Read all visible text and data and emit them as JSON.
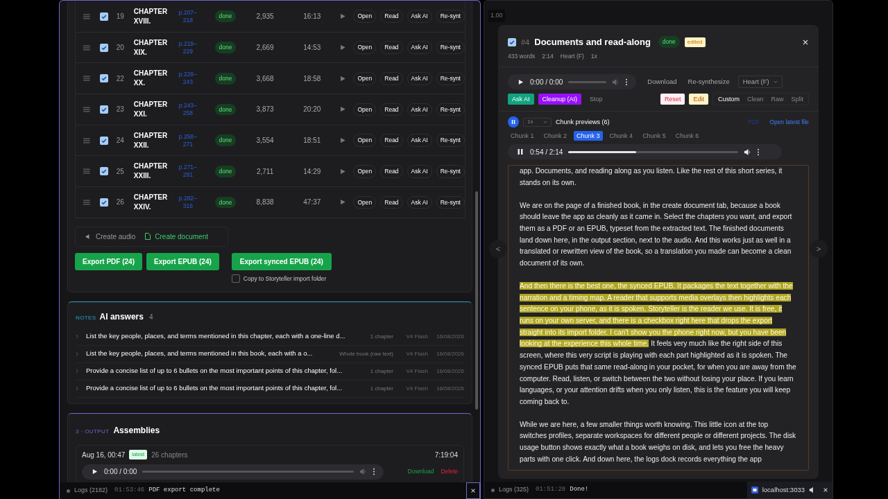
{
  "chapters": {
    "rows": [
      {
        "checked": true,
        "number": "19",
        "title": "CHAPTER XVIII.",
        "pages": "p.207–218",
        "status": "done",
        "words": "2,935",
        "duration": "16:13",
        "actions": [
          "Open",
          "Read",
          "Ask AI",
          "Re-synt"
        ]
      },
      {
        "checked": true,
        "number": "20",
        "title": "CHAPTER XIX.",
        "pages": "p.219–229",
        "status": "done",
        "words": "2,669",
        "duration": "14:53",
        "actions": [
          "Open",
          "Read",
          "Ask AI",
          "Re-synt"
        ]
      },
      {
        "checked": true,
        "number": "22",
        "title": "CHAPTER XX.",
        "pages": "p.229–243",
        "status": "done",
        "words": "3,668",
        "duration": "18:58",
        "actions": [
          "Open",
          "Read",
          "Ask AI",
          "Re-synt"
        ]
      },
      {
        "checked": true,
        "number": "23",
        "title": "CHAPTER XXI.",
        "pages": "p.243–258",
        "status": "done",
        "words": "3,873",
        "duration": "20:20",
        "actions": [
          "Open",
          "Read",
          "Ask AI",
          "Re-synt"
        ]
      },
      {
        "checked": true,
        "number": "24",
        "title": "CHAPTER XXII.",
        "pages": "p.258–271",
        "status": "done",
        "words": "3,554",
        "duration": "18:51",
        "actions": [
          "Open",
          "Read",
          "Ask AI",
          "Re-synt"
        ]
      },
      {
        "checked": true,
        "number": "25",
        "title": "CHAPTER XXIII.",
        "pages": "p.271–281",
        "status": "done",
        "words": "2,711",
        "duration": "14:29",
        "actions": [
          "Open",
          "Read",
          "Ask AI",
          "Re-synt"
        ]
      },
      {
        "checked": true,
        "number": "26",
        "title": "CHAPTER XXIV.",
        "pages": "p.282–316",
        "status": "done",
        "words": "8,838",
        "duration": "47:37",
        "actions": [
          "Open",
          "Read",
          "Ask AI",
          "Re-synt"
        ]
      }
    ],
    "mode_tabs": [
      {
        "label": "Create audio",
        "selected": false,
        "kind": "audio"
      },
      {
        "label": "Create document",
        "selected": true,
        "kind": "document"
      }
    ],
    "export_buttons": [
      "Export PDF (24)",
      "Export EPUB (24)"
    ],
    "synced_button": "Export synced EPUB (24)",
    "copy_option": {
      "label": "Copy to Storyteller import folder",
      "checked": false
    }
  },
  "notes": {
    "eyebrow": "NOTES",
    "title": "AI answers",
    "count": "4",
    "items": [
      {
        "prompt": "List the key people, places, and terms mentioned in this chapter, each with a one-line d...",
        "scope": "1 chapter",
        "model": "V4 Flash",
        "date": "16/08/2026"
      },
      {
        "prompt": "List the key people, places, and terms mentioned in this book, each with a o...",
        "scope": "Whole book (raw text)",
        "model": "V4 Flash",
        "date": "16/08/2026"
      },
      {
        "prompt": "Provide a concise list of up to 6 bullets on the most important points of this chapter, fol...",
        "scope": "1 chapter",
        "model": "V4 Flash",
        "date": "16/08/2026"
      },
      {
        "prompt": "Provide a concise list of up to 6 bullets on the most important points of this chapter, fol...",
        "scope": "1 chapter",
        "model": "V4 Flash",
        "date": "16/08/2026"
      }
    ]
  },
  "output": {
    "step": "3 · OUTPUT",
    "title": "Assemblies",
    "assembly": {
      "date": "Aug 16, 00:47",
      "badge": "latest",
      "chapters": "26 chapters",
      "duration": "7:19:04",
      "player": {
        "time": "0:00 / 0:00",
        "playing": false
      },
      "download": "Download",
      "delete": "Delete"
    }
  },
  "left_log": {
    "label": "Logs (2182)",
    "time": "01:53:46",
    "message": "PDF export complete"
  },
  "background": {
    "speed": "1.00"
  },
  "modal": {
    "checked": true,
    "index": "#4",
    "title": "Documents and read-along",
    "status": "done",
    "edited": "edited",
    "meta": [
      "433 words",
      "2:14",
      "Heart (F)",
      "1x"
    ],
    "player": {
      "time": "0:00 / 0:00",
      "playing": false
    },
    "download": "Download",
    "resynthesize": "Re-synthesize",
    "voice": "Heart (F)",
    "actions": [
      {
        "label": "Ask AI",
        "kind": "ask",
        "disabled": false
      },
      {
        "label": "Cleanup (AI)",
        "kind": "cleanup",
        "disabled": false
      },
      {
        "label": "Stop",
        "kind": "stop",
        "disabled": true
      }
    ],
    "reset": "Reset",
    "edit": "Edit",
    "views": [
      {
        "label": "Custom",
        "selected": true
      },
      {
        "label": "Clean",
        "selected": false
      },
      {
        "label": "Raw",
        "selected": false
      },
      {
        "label": "Split",
        "selected": false
      }
    ],
    "chunk_speed": "1x",
    "chunk_title": "Chunk previews (6)",
    "pdf_link": {
      "label": "PDF",
      "disabled": true
    },
    "open_latest": "Open latest file",
    "chunks": [
      {
        "label": "Chunk 1",
        "selected": false
      },
      {
        "label": "Chunk 2",
        "selected": false
      },
      {
        "label": "Chunk 3",
        "selected": true
      },
      {
        "label": "Chunk 4",
        "selected": false
      },
      {
        "label": "Chunk 5",
        "selected": false
      },
      {
        "label": "Chunk 6",
        "selected": false
      }
    ],
    "chunk_player": {
      "time": "0:54 / 2:14",
      "playing": true,
      "level": 0.4
    },
    "prev": "<",
    "next": ">",
    "paragraphs": [
      [
        {
          "text": "app. Documents, and reading along as you listen. Like the rest of this short series, it stands on its own.",
          "highlighted": false
        }
      ],
      [
        {
          "text": "We are on the page of a finished book, in the create document tab, because a book should leave the app as cleanly as it came in. Select the chapters you want, and export them as a PDF or an EPUB, typeset from the extracted text. The finished documents land down here, in the output section, next to the audio. And this works just as well in a translated or rewritten view of the book, so a translation you made can become a clean document of its own.",
          "highlighted": false
        }
      ],
      [
        {
          "text": "And then there is the best one, the synced EPUB. It packages the text together with the narration and a timing map. A reader that supports media overlays then highlights each sentence on your phone, as it is spoken. Storyteller is the reader we use. It is free, it runs on your own server, and there is a checkbox right here that drops the export straight into its import folder. I can't show you the phone right now, but you have been looking at the experience this whole time.",
          "highlighted": true
        },
        {
          "text": " It feels very much like the right side of this screen, where this very script is playing with each part highlighted as it is spoken. The synced EPUB puts that same read-along in your pocket, for when you are away from the computer. Read, listen, or switch between the two without losing your place. If you learn languages, or your attention drifts when you only listen, this is the feature you will keep coming back to.",
          "highlighted": false
        }
      ],
      [
        {
          "text": "While we are here, a few smaller things worth knowing. This little icon at the top switches profiles, separate workspaces for different people or different projects. The disk usage button shows exactly what a book weighs on disk, and lets you free the heavy parts with one click. And down here, the logs dock records everything the app",
          "highlighted": false
        }
      ]
    ]
  },
  "right_log": {
    "label": "Logs (325)",
    "time": "01:51:28",
    "message": "Done!"
  },
  "share_pill": {
    "label": "localhost:3033"
  }
}
